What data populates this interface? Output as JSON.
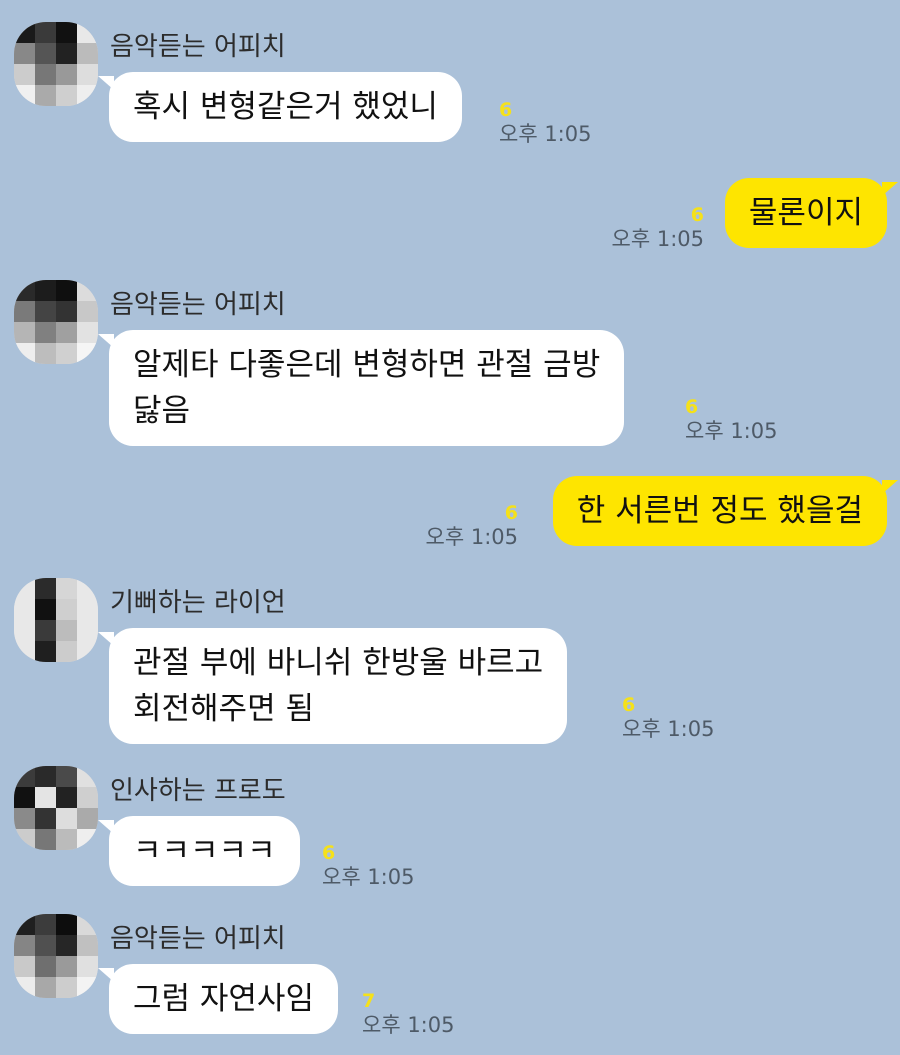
{
  "colors": {
    "background": "#abc1d9",
    "incoming_bubble": "#ffffff",
    "outgoing_bubble": "#fee500",
    "unread_count": "#f5e11a",
    "timestamp": "#4e5a67"
  },
  "messages": [
    {
      "direction": "in",
      "sender": "음악듣는 어피치",
      "avatar_icon": "pixelated-avatar-icon",
      "lines": [
        "혹시 변형같은거 했었니"
      ],
      "unread": "6",
      "time": "오후 1:05"
    },
    {
      "direction": "out",
      "lines": [
        "물론이지"
      ],
      "unread": "6",
      "time": "오후 1:05"
    },
    {
      "direction": "in",
      "sender": "음악듣는 어피치",
      "avatar_icon": "pixelated-avatar-icon",
      "lines": [
        "알제타 다좋은데 변형하면 관절 금방",
        "닳음"
      ],
      "unread": "6",
      "time": "오후 1:05"
    },
    {
      "direction": "out",
      "lines": [
        "한 서른번 정도 했을걸"
      ],
      "unread": "6",
      "time": "오후 1:05"
    },
    {
      "direction": "in",
      "sender": "기뻐하는 라이언",
      "avatar_icon": "pixelated-avatar-icon",
      "lines": [
        "관절 부에 바니쉬 한방울 바르고",
        "회전해주면 됨"
      ],
      "unread": "6",
      "time": "오후 1:05"
    },
    {
      "direction": "in",
      "sender": "인사하는 프로도",
      "avatar_icon": "pixelated-avatar-icon",
      "lines": [
        "ㅋㅋㅋㅋㅋ"
      ],
      "unread": "6",
      "time": "오후 1:05"
    },
    {
      "direction": "in",
      "sender": "음악듣는 어피치",
      "avatar_icon": "pixelated-avatar-icon",
      "lines": [
        "그럼 자연사임"
      ],
      "unread": "7",
      "time": "오후 1:05"
    }
  ]
}
